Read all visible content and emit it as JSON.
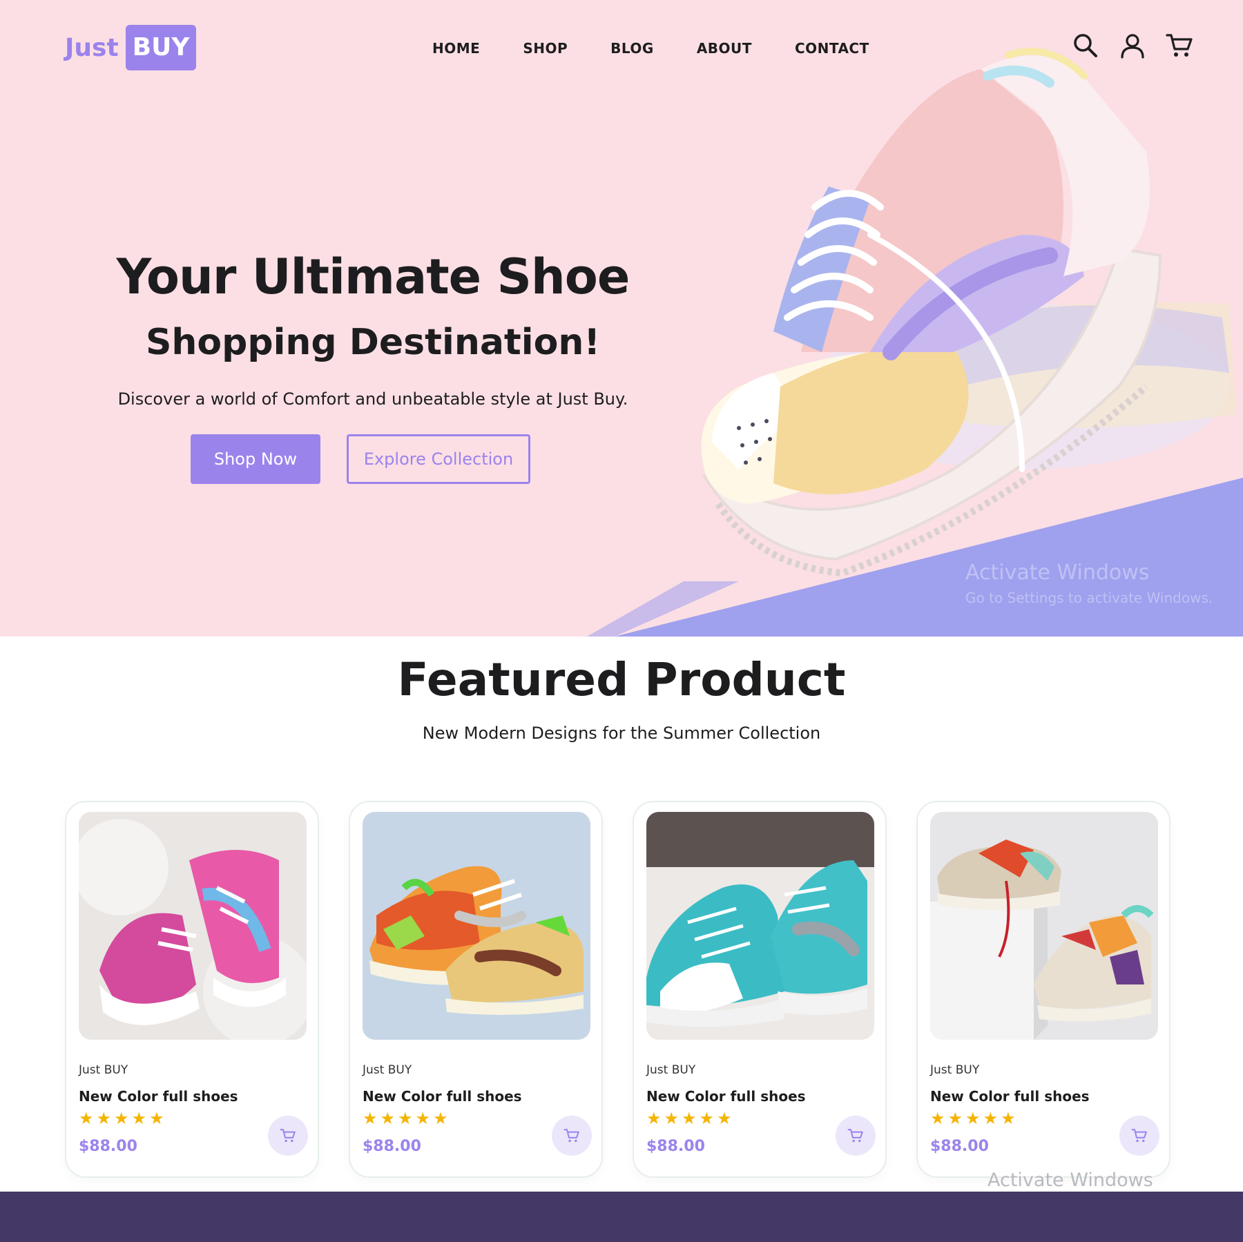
{
  "brand": {
    "first": "Just",
    "second": "BUY"
  },
  "nav": {
    "items": [
      {
        "label": "HOME"
      },
      {
        "label": "SHOP"
      },
      {
        "label": "BLOG"
      },
      {
        "label": "ABOUT"
      },
      {
        "label": "CONTACT"
      }
    ]
  },
  "header_icons": [
    "search-icon",
    "user-icon",
    "cart-icon"
  ],
  "hero": {
    "title_line1": "Your Ultimate Shoe",
    "title_line2": "Shopping Destination!",
    "subtitle": "Discover a world of Comfort and unbeatable style at Just Buy.",
    "primary_button": "Shop Now",
    "secondary_button": "Explore Collection"
  },
  "watermark": {
    "line1": "Activate Windows",
    "line2": "Go to Settings to activate Windows.",
    "line3": "Activate Windows"
  },
  "featured": {
    "title": "Featured Product",
    "subtitle": "New Modern Designs for the Summer Collection",
    "products": [
      {
        "brand": "Just BUY",
        "name": "New Color full shoes",
        "rating": 5,
        "price": "$88.00"
      },
      {
        "brand": "Just BUY",
        "name": "New Color full shoes",
        "rating": 5,
        "price": "$88.00"
      },
      {
        "brand": "Just BUY",
        "name": "New Color full shoes",
        "rating": 5,
        "price": "$88.00"
      },
      {
        "brand": "Just BUY",
        "name": "New Color full shoes",
        "rating": 5,
        "price": "$88.00"
      }
    ]
  },
  "colors": {
    "accent": "#9b83ec",
    "hero_bg": "#fbdfe4",
    "floor": "#9fa0ee",
    "star": "#f4b400",
    "footer": "#443966"
  }
}
